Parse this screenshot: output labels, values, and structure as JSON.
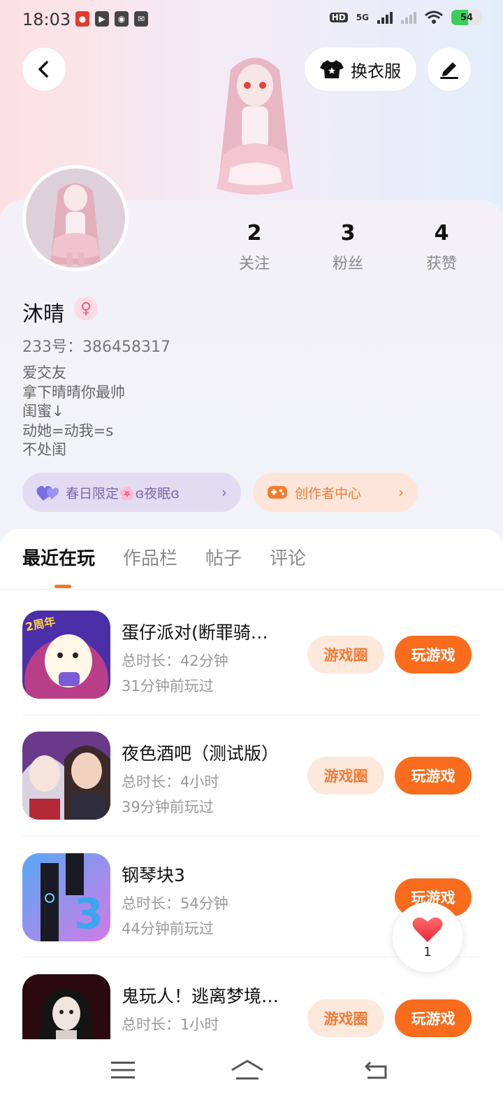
{
  "status_bar": {
    "time": "18:03",
    "network_label": "5G",
    "battery": "54",
    "app_icons": [
      "app-icon-1",
      "app-icon-2",
      "app-icon-3",
      "app-icon-4"
    ]
  },
  "header": {
    "outfit_label": "换衣服"
  },
  "stats": [
    {
      "value": "2",
      "label": "关注"
    },
    {
      "value": "3",
      "label": "粉丝"
    },
    {
      "value": "4",
      "label": "获赞"
    }
  ],
  "profile": {
    "name": "沐晴",
    "gender_icon": "♀",
    "id_line": "233号：386458317",
    "bio": [
      "爱交友",
      "拿下晴晴你最帅",
      "闺蜜↓",
      "动她=动我=s",
      "不处闺"
    ]
  },
  "pills": {
    "spring": "春日限定🌸ɞ夜眠ɞ",
    "creator": "创作者中心"
  },
  "tabs": [
    "最近在玩",
    "作品栏",
    "帖子",
    "评论"
  ],
  "games": [
    {
      "title": "蛋仔派对(断罪骑…",
      "duration": "总时长：42分钟",
      "last_played": "31分钟前玩过",
      "circle_label": "游戏圈",
      "play_label": "玩游戏",
      "icon_badge": "2周年"
    },
    {
      "title": "夜色酒吧（测试版）",
      "duration": "总时长：4小时",
      "last_played": "39分钟前玩过",
      "circle_label": "游戏圈",
      "play_label": "玩游戏"
    },
    {
      "title": "钢琴块3",
      "duration": "总时长：54分钟",
      "last_played": "44分钟前玩过",
      "play_label": "玩游戏",
      "icon_badge": "3"
    },
    {
      "title": "鬼玩人！逃离梦境…",
      "duration": "总时长：1小时",
      "circle_label": "游戏圈",
      "play_label": "玩游戏"
    }
  ],
  "like_fab": {
    "count": "1"
  },
  "colors": {
    "accent": "#f86c1c",
    "accent_light": "#fde8dc",
    "spring_pill": "#e2dcf3"
  }
}
